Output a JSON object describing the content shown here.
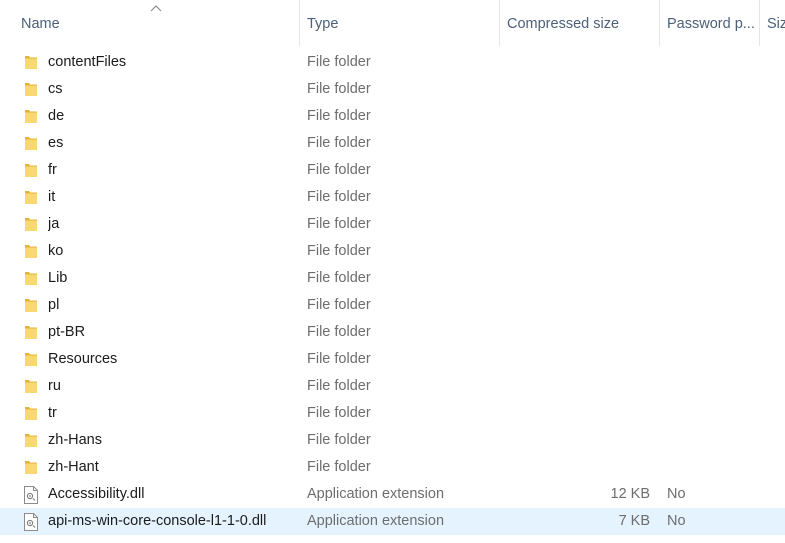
{
  "columns": {
    "name": "Name",
    "type": "Type",
    "compressed_size": "Compressed size",
    "password": "Password p...",
    "size": "Siz"
  },
  "sort": {
    "column": "Name",
    "direction": "ascending"
  },
  "rows": [
    {
      "icon": "folder-icon",
      "name": "contentFiles",
      "type": "File folder",
      "compressed_size": "",
      "password": ""
    },
    {
      "icon": "folder-icon",
      "name": "cs",
      "type": "File folder",
      "compressed_size": "",
      "password": ""
    },
    {
      "icon": "folder-icon",
      "name": "de",
      "type": "File folder",
      "compressed_size": "",
      "password": ""
    },
    {
      "icon": "folder-icon",
      "name": "es",
      "type": "File folder",
      "compressed_size": "",
      "password": ""
    },
    {
      "icon": "folder-icon",
      "name": "fr",
      "type": "File folder",
      "compressed_size": "",
      "password": ""
    },
    {
      "icon": "folder-icon",
      "name": "it",
      "type": "File folder",
      "compressed_size": "",
      "password": ""
    },
    {
      "icon": "folder-icon",
      "name": "ja",
      "type": "File folder",
      "compressed_size": "",
      "password": ""
    },
    {
      "icon": "folder-icon",
      "name": "ko",
      "type": "File folder",
      "compressed_size": "",
      "password": ""
    },
    {
      "icon": "folder-icon",
      "name": "Lib",
      "type": "File folder",
      "compressed_size": "",
      "password": ""
    },
    {
      "icon": "folder-icon",
      "name": "pl",
      "type": "File folder",
      "compressed_size": "",
      "password": ""
    },
    {
      "icon": "folder-icon",
      "name": "pt-BR",
      "type": "File folder",
      "compressed_size": "",
      "password": ""
    },
    {
      "icon": "folder-icon",
      "name": "Resources",
      "type": "File folder",
      "compressed_size": "",
      "password": ""
    },
    {
      "icon": "folder-icon",
      "name": "ru",
      "type": "File folder",
      "compressed_size": "",
      "password": ""
    },
    {
      "icon": "folder-icon",
      "name": "tr",
      "type": "File folder",
      "compressed_size": "",
      "password": ""
    },
    {
      "icon": "folder-icon",
      "name": "zh-Hans",
      "type": "File folder",
      "compressed_size": "",
      "password": ""
    },
    {
      "icon": "folder-icon",
      "name": "zh-Hant",
      "type": "File folder",
      "compressed_size": "",
      "password": ""
    },
    {
      "icon": "dll-file-icon",
      "name": "Accessibility.dll",
      "type": "Application extension",
      "compressed_size": "12 KB",
      "password": "No"
    },
    {
      "icon": "dll-file-icon",
      "name": "api-ms-win-core-console-l1-1-0.dll",
      "type": "Application extension",
      "compressed_size": "7 KB",
      "password": "No",
      "selected": true
    }
  ],
  "colors": {
    "folder": "#f8d775",
    "folder_dark": "#e4b33c",
    "selection": "#e5f3ff",
    "header_text": "#4c607a",
    "secondary_text": "#6d6d6d"
  }
}
